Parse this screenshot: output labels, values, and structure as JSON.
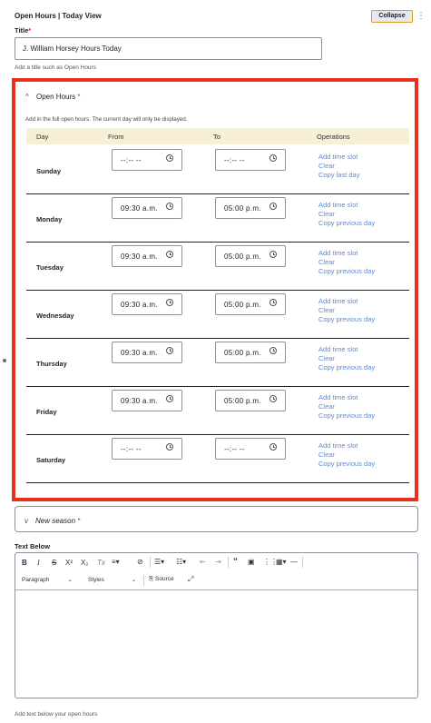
{
  "header": {
    "title": "Open Hours | Today View",
    "collapse_label": "Collapse",
    "more_icon": "⋮"
  },
  "title_field": {
    "label": "Title",
    "value": "J. William Horsey Hours Today",
    "help": "Add a title such as Open Hours"
  },
  "open_hours": {
    "summary": "Open Hours",
    "intro": "Add in the full open hours. The current day will only be displayed.",
    "columns": {
      "day": "Day",
      "from": "From",
      "to": "To",
      "operations": "Operations"
    },
    "rows": [
      {
        "day": "Sunday",
        "from": "--:-- --",
        "to": "--:-- --",
        "ops": [
          "Add time slot",
          "Clear",
          "Copy last day"
        ]
      },
      {
        "day": "Monday",
        "from": "09:30 a.m.",
        "to": "05:00 p.m.",
        "ops": [
          "Add time slot",
          "Clear",
          "Copy previous day"
        ]
      },
      {
        "day": "Tuesday",
        "from": "09:30 a.m.",
        "to": "05:00 p.m.",
        "ops": [
          "Add time slot",
          "Clear",
          "Copy previous day"
        ]
      },
      {
        "day": "Wednesday",
        "from": "09:30 a.m.",
        "to": "05:00 p.m.",
        "ops": [
          "Add time slot",
          "Clear",
          "Copy previous day"
        ]
      },
      {
        "day": "Thursday",
        "from": "09:30 a.m.",
        "to": "05:00 p.m.",
        "ops": [
          "Add time slot",
          "Clear",
          "Copy previous day"
        ]
      },
      {
        "day": "Friday",
        "from": "09:30 a.m.",
        "to": "05:00 p.m.",
        "ops": [
          "Add time slot",
          "Clear",
          "Copy previous day"
        ]
      },
      {
        "day": "Saturday",
        "from": "--:-- --",
        "to": "--:-- --",
        "ops": [
          "Add time slot",
          "Clear",
          "Copy previous day"
        ]
      }
    ]
  },
  "new_season": {
    "label": "New season"
  },
  "text_below": {
    "label": "Text Below",
    "toolbar": {
      "bold": "B",
      "italic": "I",
      "strike": "S",
      "superscript": "X²",
      "subscript": "X₂",
      "remove_format": "Tx",
      "paragraph": "Paragraph",
      "styles": "Styles",
      "source": "Source"
    },
    "help": "Add text below your open hours"
  },
  "colors": {
    "highlight": "#e8321e",
    "header_bg": "#f8f0d6",
    "link": "#5d8ad3",
    "required": "#d8263a"
  }
}
